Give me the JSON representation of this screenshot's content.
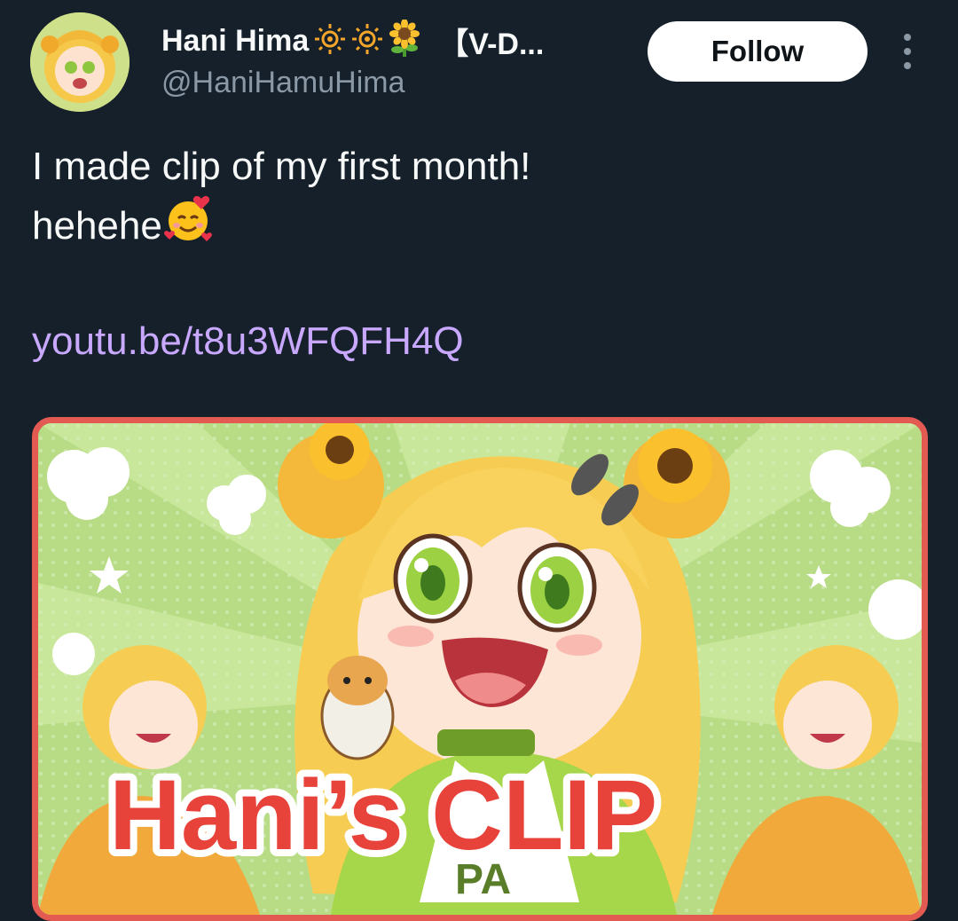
{
  "author": {
    "display_name": "Hani Hima",
    "name_emojis": [
      "sun-icon",
      "sun-icon",
      "sunflower-icon"
    ],
    "name_suffix": "【V-D...",
    "handle": "@HaniHamuHima"
  },
  "actions": {
    "follow_label": "Follow",
    "more_icon": "more-vertical-icon"
  },
  "tweet": {
    "line1": "I made clip of my first month!",
    "line2": "hehehe",
    "line2_emoji": "smiling-face-with-hearts-icon",
    "link": "youtu.be/t8u3WFQFH4Q"
  },
  "media": {
    "thumbnail_text_1": "Hani",
    "thumbnail_text_2": "’s CLIP",
    "thumbnail_letters_shirt": "PA"
  },
  "colors": {
    "background": "#15202b",
    "link": "#c9a8ff",
    "secondary_text": "#8b98a5",
    "thumbnail_border": "#e25a52",
    "thumbnail_title": "#e8433b"
  }
}
